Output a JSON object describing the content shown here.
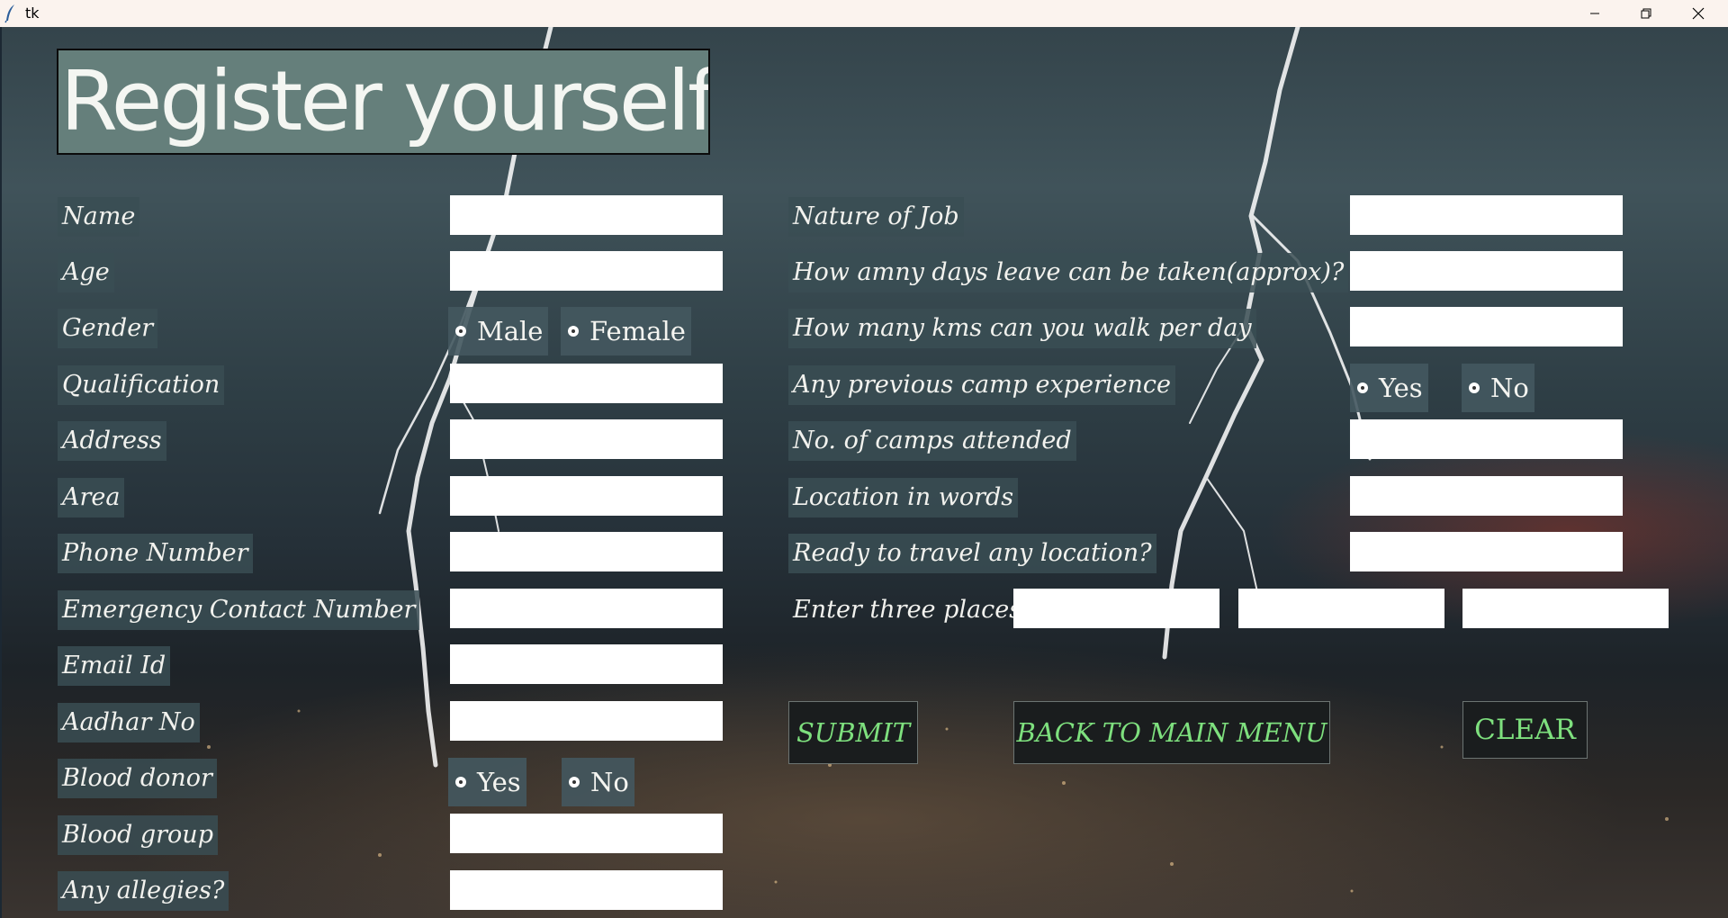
{
  "window": {
    "title": "tk"
  },
  "heading": "Register yourself",
  "left_labels": [
    "Name",
    "Age",
    "Gender",
    "Qualification",
    "Address",
    "Area",
    "Phone Number",
    "Emergency Contact Number",
    "Email Id",
    "Aadhar No",
    "Blood donor",
    "Blood group",
    "Any allegies?"
  ],
  "gender": {
    "male": "Male",
    "female": "Female"
  },
  "blood_donor": {
    "yes": "Yes",
    "no": "No"
  },
  "right_labels": [
    "Nature of Job",
    "How amny days leave can be taken(approx)?",
    "How many kms can you walk per day",
    "Any previous camp experience",
    "No. of camps attended",
    "Location in words",
    "Ready to travel any location?",
    "Enter three places :"
  ],
  "camp_experience": {
    "yes": "Yes",
    "no": "No"
  },
  "buttons": {
    "submit": "SUBMIT",
    "back": "BACK TO MAIN MENU",
    "clear": "CLEAR"
  },
  "colors": {
    "button_text": "#7ee07e",
    "heading_bg": "#657f7b",
    "label_bg": "#3a4e54"
  },
  "icons": {
    "app": "feather-icon",
    "minimize": "minimize-icon",
    "maximize": "restore-icon",
    "close": "close-icon"
  }
}
